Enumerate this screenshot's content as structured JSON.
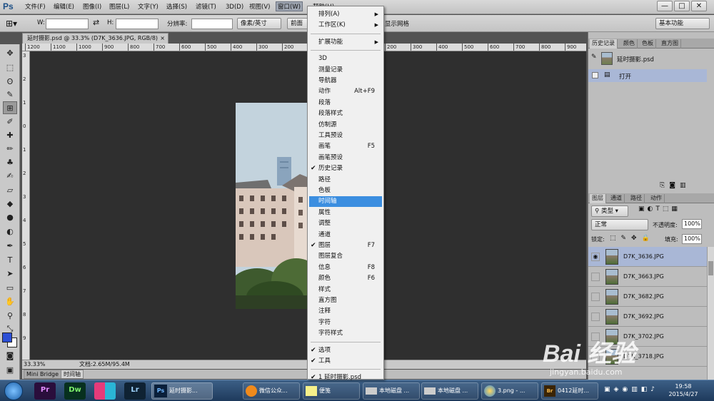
{
  "app": {
    "logo": "Ps"
  },
  "menubar": {
    "items": [
      "文件(F)",
      "编辑(E)",
      "图像(I)",
      "图层(L)",
      "文字(Y)",
      "选择(S)",
      "滤镜(T)",
      "3D(D)",
      "视图(V)",
      "窗口(W)",
      "帮助(H)"
    ],
    "window_buttons": [
      "—",
      "□",
      "✕"
    ]
  },
  "options": {
    "w_label": "W:",
    "h_label": "H:",
    "resolution_label": "分辨率:",
    "unit_value": "像素/英寸",
    "front_btn": "前面",
    "grid_label": "显示网格",
    "workspace": "基本功能"
  },
  "document": {
    "tab_title": "延时摄影.psd @ 33.3% (D7K_3636.JPG, RGB/8)",
    "tab_close": "×",
    "ruler_ticks": [
      "1200",
      "1100",
      "1000",
      "900",
      "800",
      "700",
      "600",
      "500",
      "400",
      "300",
      "200",
      "100",
      "0",
      "100",
      "200",
      "300",
      "400",
      "500",
      "600",
      "700",
      "800",
      "900"
    ],
    "vruler_ticks": [
      "3",
      "2",
      "1",
      "0",
      "1",
      "2",
      "3",
      "4",
      "5",
      "6",
      "7",
      "8",
      "9"
    ],
    "zoom": "33.33%",
    "doc_info": "文档:2.65M/95.4M",
    "bottom_tabs": [
      "Mini Bridge",
      "时间轴"
    ]
  },
  "window_menu": {
    "items": [
      {
        "label": "排列(A)",
        "submenu": true
      },
      {
        "label": "工作区(K)",
        "submenu": true
      },
      {
        "sep": true
      },
      {
        "label": "扩展功能",
        "submenu": true
      },
      {
        "sep": true
      },
      {
        "label": "3D"
      },
      {
        "label": "测量记录"
      },
      {
        "label": "导航器"
      },
      {
        "label": "动作",
        "shortcut": "Alt+F9"
      },
      {
        "label": "段落"
      },
      {
        "label": "段落样式"
      },
      {
        "label": "仿制源"
      },
      {
        "label": "工具预设"
      },
      {
        "label": "画笔",
        "shortcut": "F5"
      },
      {
        "label": "画笔预设"
      },
      {
        "label": "历史记录",
        "checked": true
      },
      {
        "label": "路径"
      },
      {
        "label": "色板"
      },
      {
        "label": "时间轴",
        "highlighted": true
      },
      {
        "label": "属性"
      },
      {
        "label": "调整"
      },
      {
        "label": "通道"
      },
      {
        "label": "图层",
        "checked": true,
        "shortcut": "F7"
      },
      {
        "label": "图层复合"
      },
      {
        "label": "信息",
        "shortcut": "F8"
      },
      {
        "label": "颜色",
        "shortcut": "F6"
      },
      {
        "label": "样式"
      },
      {
        "label": "直方图"
      },
      {
        "label": "注释"
      },
      {
        "label": "字符"
      },
      {
        "label": "字符样式"
      },
      {
        "sep": true
      },
      {
        "label": "选项",
        "checked": true
      },
      {
        "label": "工具",
        "checked": true
      },
      {
        "sep": true
      },
      {
        "label": "1 延时摄影.psd",
        "checked": true
      }
    ]
  },
  "history_panel": {
    "tabs": [
      "历史记录",
      "颜色",
      "色板",
      "直方图"
    ],
    "snapshot": "延时摄影.psd",
    "step": "打开"
  },
  "layers_panel": {
    "tabs": [
      "图层",
      "通道",
      "路径",
      "动作"
    ],
    "filter": "类型",
    "blend_mode": "正常",
    "opacity_label": "不透明度:",
    "opacity": "100%",
    "lock_label": "锁定:",
    "fill_label": "填充:",
    "fill": "100%",
    "layers": [
      "D7K_3636.JPG",
      "D7K_3663.JPG",
      "D7K_3682.JPG",
      "D7K_3692.JPG",
      "D7K_3702.JPG",
      "D7K_3718.JPG"
    ]
  },
  "taskbar": {
    "apps": [
      "Pr",
      "Dw",
      "",
      "Lr",
      "Ps"
    ],
    "items": [
      "延时摄影...",
      "",
      "微信公众...",
      "便笺",
      "本地磁盘 ...",
      "本地磁盘 ...",
      "3.png - ...",
      "0412延时..."
    ],
    "time": "19:58",
    "date": "2015/4/27"
  },
  "watermark": {
    "logo": "Bai  经验",
    "url": "jingyan.baidu.com"
  },
  "colors": {
    "highlight": "#3b8ee0",
    "canvas": "#2f2f2f"
  }
}
